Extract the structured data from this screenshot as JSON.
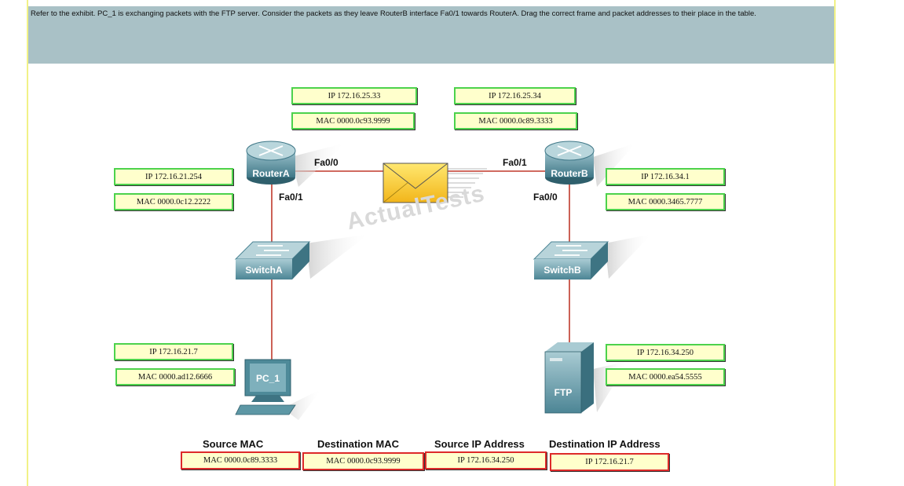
{
  "instructions": "Refer to the exhibit. PC_1 is exchanging packets with the FTP server. Consider the packets as they leave RouterB interface Fa0/1 towards RouterA. Drag the correct frame and packet addresses to their place in the table.",
  "watermark": "ActualTests",
  "devices": {
    "router_a": "RouterA",
    "router_b": "RouterB",
    "switch_a": "SwitchA",
    "switch_b": "SwitchB",
    "pc": "PC_1",
    "server": "FTP"
  },
  "interfaces": {
    "router_a_fa00": "Fa0/0",
    "router_a_fa01": "Fa0/1",
    "router_b_fa01": "Fa0/1",
    "router_b_fa00": "Fa0/0"
  },
  "address_labels": {
    "router_a_fa00_ip": "IP 172.16.25.33",
    "router_a_fa00_mac": "MAC 0000.0c93.9999",
    "router_b_fa01_ip": "IP 172.16.25.34",
    "router_b_fa01_mac": "MAC 0000.0c89.3333",
    "router_a_fa01_ip": "IP 172.16.21.254",
    "router_a_fa01_mac": "MAC 0000.0c12.2222",
    "router_b_fa00_ip": "IP 172.16.34.1",
    "router_b_fa00_mac": "MAC 0000.3465.7777",
    "pc_ip": "IP 172.16.21.7",
    "pc_mac": "MAC 0000.ad12.6666",
    "ftp_ip": "IP 172.16.34.250",
    "ftp_mac": "MAC 0000.ea54.5555"
  },
  "answer_table": {
    "headers": [
      "Source MAC",
      "Destination MAC",
      "Source IP Address",
      "Destination IP Address"
    ],
    "values": [
      "MAC 0000.0c89.3333",
      "MAC 0000.0c93.9999",
      "IP 172.16.34.250",
      "IP 172.16.21.7"
    ]
  },
  "colors": {
    "header_bg": "#a9c1c6",
    "frame_border": "#f1f186",
    "label_fill": "#ffffcc",
    "label_border": "#4cd24c",
    "answer_border": "#dd2a2a",
    "link": "#c0392b",
    "device": "#4e8a99"
  }
}
